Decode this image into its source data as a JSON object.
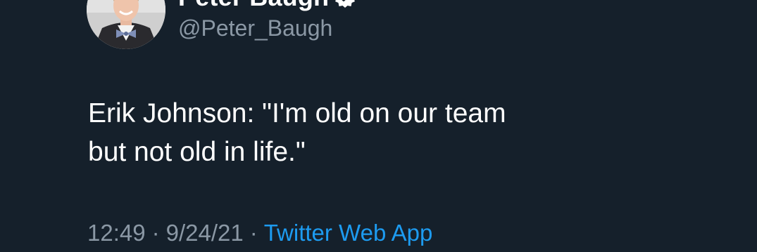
{
  "author": {
    "display_name": "Peter Baugh",
    "handle": "@Peter_Baugh",
    "verified_icon": "verified-badge-icon"
  },
  "tweet": {
    "lines": [
      "Erik Johnson: \"I'm old on our team",
      "but not old in life.\""
    ]
  },
  "meta": {
    "time": "12:49",
    "separator": "·",
    "date": "9/24/21",
    "source": "Twitter Web App"
  },
  "colors": {
    "background": "#15202b",
    "text": "#ffffff",
    "secondary": "#8b98a5",
    "link": "#1d9bf0"
  }
}
